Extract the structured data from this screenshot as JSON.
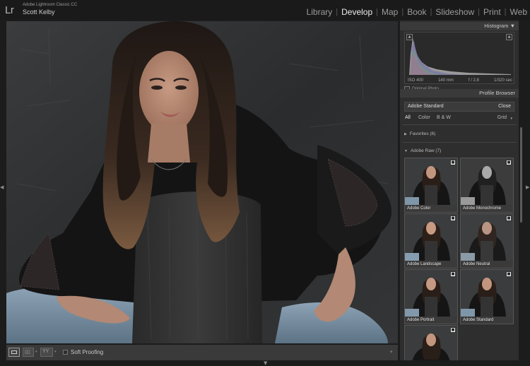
{
  "app": {
    "logo": "Lr",
    "product": "Adobe Lightroom Classic CC",
    "user": "Scott Kelby"
  },
  "modules": [
    {
      "label": "Library",
      "active": false
    },
    {
      "label": "Develop",
      "active": true
    },
    {
      "label": "Map",
      "active": false
    },
    {
      "label": "Book",
      "active": false
    },
    {
      "label": "Slideshow",
      "active": false
    },
    {
      "label": "Print",
      "active": false
    },
    {
      "label": "Web",
      "active": false
    }
  ],
  "histogram": {
    "title": "Histogram",
    "iso": "ISO 400",
    "focal": "140 mm",
    "aperture": "f / 2.8",
    "shutter": "1/320 sec",
    "original_label": "Original Photo"
  },
  "profile_browser": {
    "title": "Profile Browser",
    "current": "Adobe Standard",
    "close_label": "Close",
    "filters": [
      "All",
      "Color",
      "B & W"
    ],
    "view_label": "Grid",
    "groups": [
      {
        "label": "Favorites (6)",
        "expanded": false
      },
      {
        "label": "Adobe Raw (7)",
        "expanded": true
      }
    ],
    "profiles": [
      "Adobe Color",
      "Adobe Monochrome",
      "Adobe Landscape",
      "Adobe Neutral",
      "Adobe Portrait",
      "Adobe Standard",
      ""
    ]
  },
  "toolbar": {
    "soft_proofing": "Soft Proofing"
  },
  "icons": {
    "panel_collapse": "triangle-down-icon",
    "disclosure": "triangle-icon",
    "favorite": "favorite-badge-icon"
  },
  "colors": {
    "active_module": "#ececec",
    "inactive_module": "#9c9c9c",
    "panel_bg": "#2e2e2e"
  }
}
